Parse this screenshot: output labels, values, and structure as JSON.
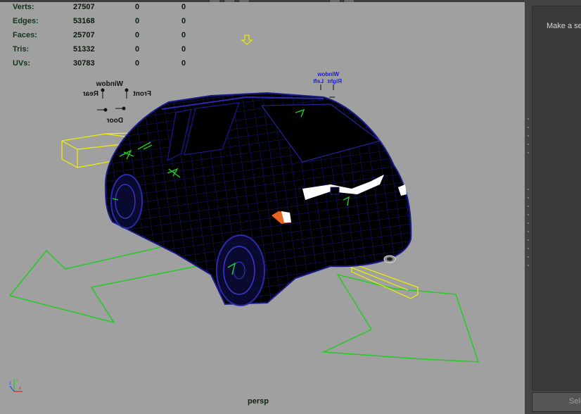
{
  "viewport": {
    "camera": "persp",
    "background": "#a0a0a0"
  },
  "hud": {
    "rows": [
      {
        "label": "Verts:",
        "v1": "27507",
        "v2": "0",
        "v3": "0"
      },
      {
        "label": "Edges:",
        "v1": "53168",
        "v2": "0",
        "v3": "0"
      },
      {
        "label": "Faces:",
        "v1": "25707",
        "v2": "0",
        "v3": "0"
      },
      {
        "label": "Tris:",
        "v1": "51332",
        "v2": "0",
        "v3": "0"
      },
      {
        "label": "UVs:",
        "v1": "30783",
        "v2": "0",
        "v3": "0"
      }
    ]
  },
  "rig_labels": {
    "left_group": [
      "Window",
      "Rear",
      "Front",
      "Door"
    ],
    "right_group": [
      "Window",
      "Left",
      "Right"
    ]
  },
  "colors": {
    "wireframe": "#1a1a8c",
    "body": "#000000",
    "controls_green": "#22cc22",
    "controls_yellow": "#f0f000",
    "panel_bg": "#3a3a3a"
  },
  "axis_indicator": {
    "x": "x",
    "y": "y",
    "z": "z"
  },
  "sidebar": {
    "message": "Make a selection",
    "button_label": "Select"
  }
}
